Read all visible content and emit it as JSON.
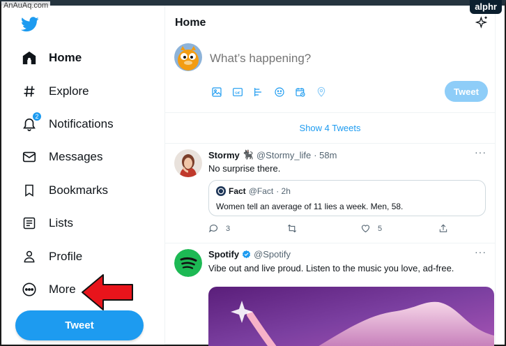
{
  "watermark": "AnAuAq.com",
  "brand_badge": "alphr",
  "sidebar": {
    "items": [
      {
        "label": "Home",
        "icon": "home-icon"
      },
      {
        "label": "Explore",
        "icon": "hashtag-icon"
      },
      {
        "label": "Notifications",
        "icon": "bell-icon",
        "badge": "2"
      },
      {
        "label": "Messages",
        "icon": "envelope-icon"
      },
      {
        "label": "Bookmarks",
        "icon": "bookmark-icon"
      },
      {
        "label": "Lists",
        "icon": "list-icon"
      },
      {
        "label": "Profile",
        "icon": "person-icon"
      },
      {
        "label": "More",
        "icon": "more-circle-icon"
      }
    ],
    "tweet_button": "Tweet"
  },
  "header": {
    "title": "Home"
  },
  "composer": {
    "placeholder": "What’s happening?",
    "tools": [
      "image-icon",
      "gif-icon",
      "poll-icon",
      "emoji-icon",
      "schedule-icon",
      "location-icon"
    ],
    "tweet_button": "Tweet"
  },
  "show_tweets": "Show 4 Tweets",
  "tweets": [
    {
      "name": "Stormy",
      "emoji": "🐈‍⬛",
      "handle": "@Stormy_life",
      "time": "· 58m",
      "text": "No surprise there.",
      "more": "···",
      "quote": {
        "name": "Fact",
        "handle": "@Fact",
        "time": "· 2h",
        "text": "Women tell an average of 11 lies a week. Men, 58."
      },
      "replies": "3",
      "likes": "5"
    },
    {
      "name": "Spotify",
      "handle": "@Spotify",
      "text": "Vibe out and live proud. Listen to the music you love, ad-free.",
      "more": "···"
    }
  ],
  "colors": {
    "accent": "#1d9bf0",
    "accent_disabled": "#8ecdf8",
    "arrow": "#e8141b",
    "spotify": "#1db954"
  }
}
